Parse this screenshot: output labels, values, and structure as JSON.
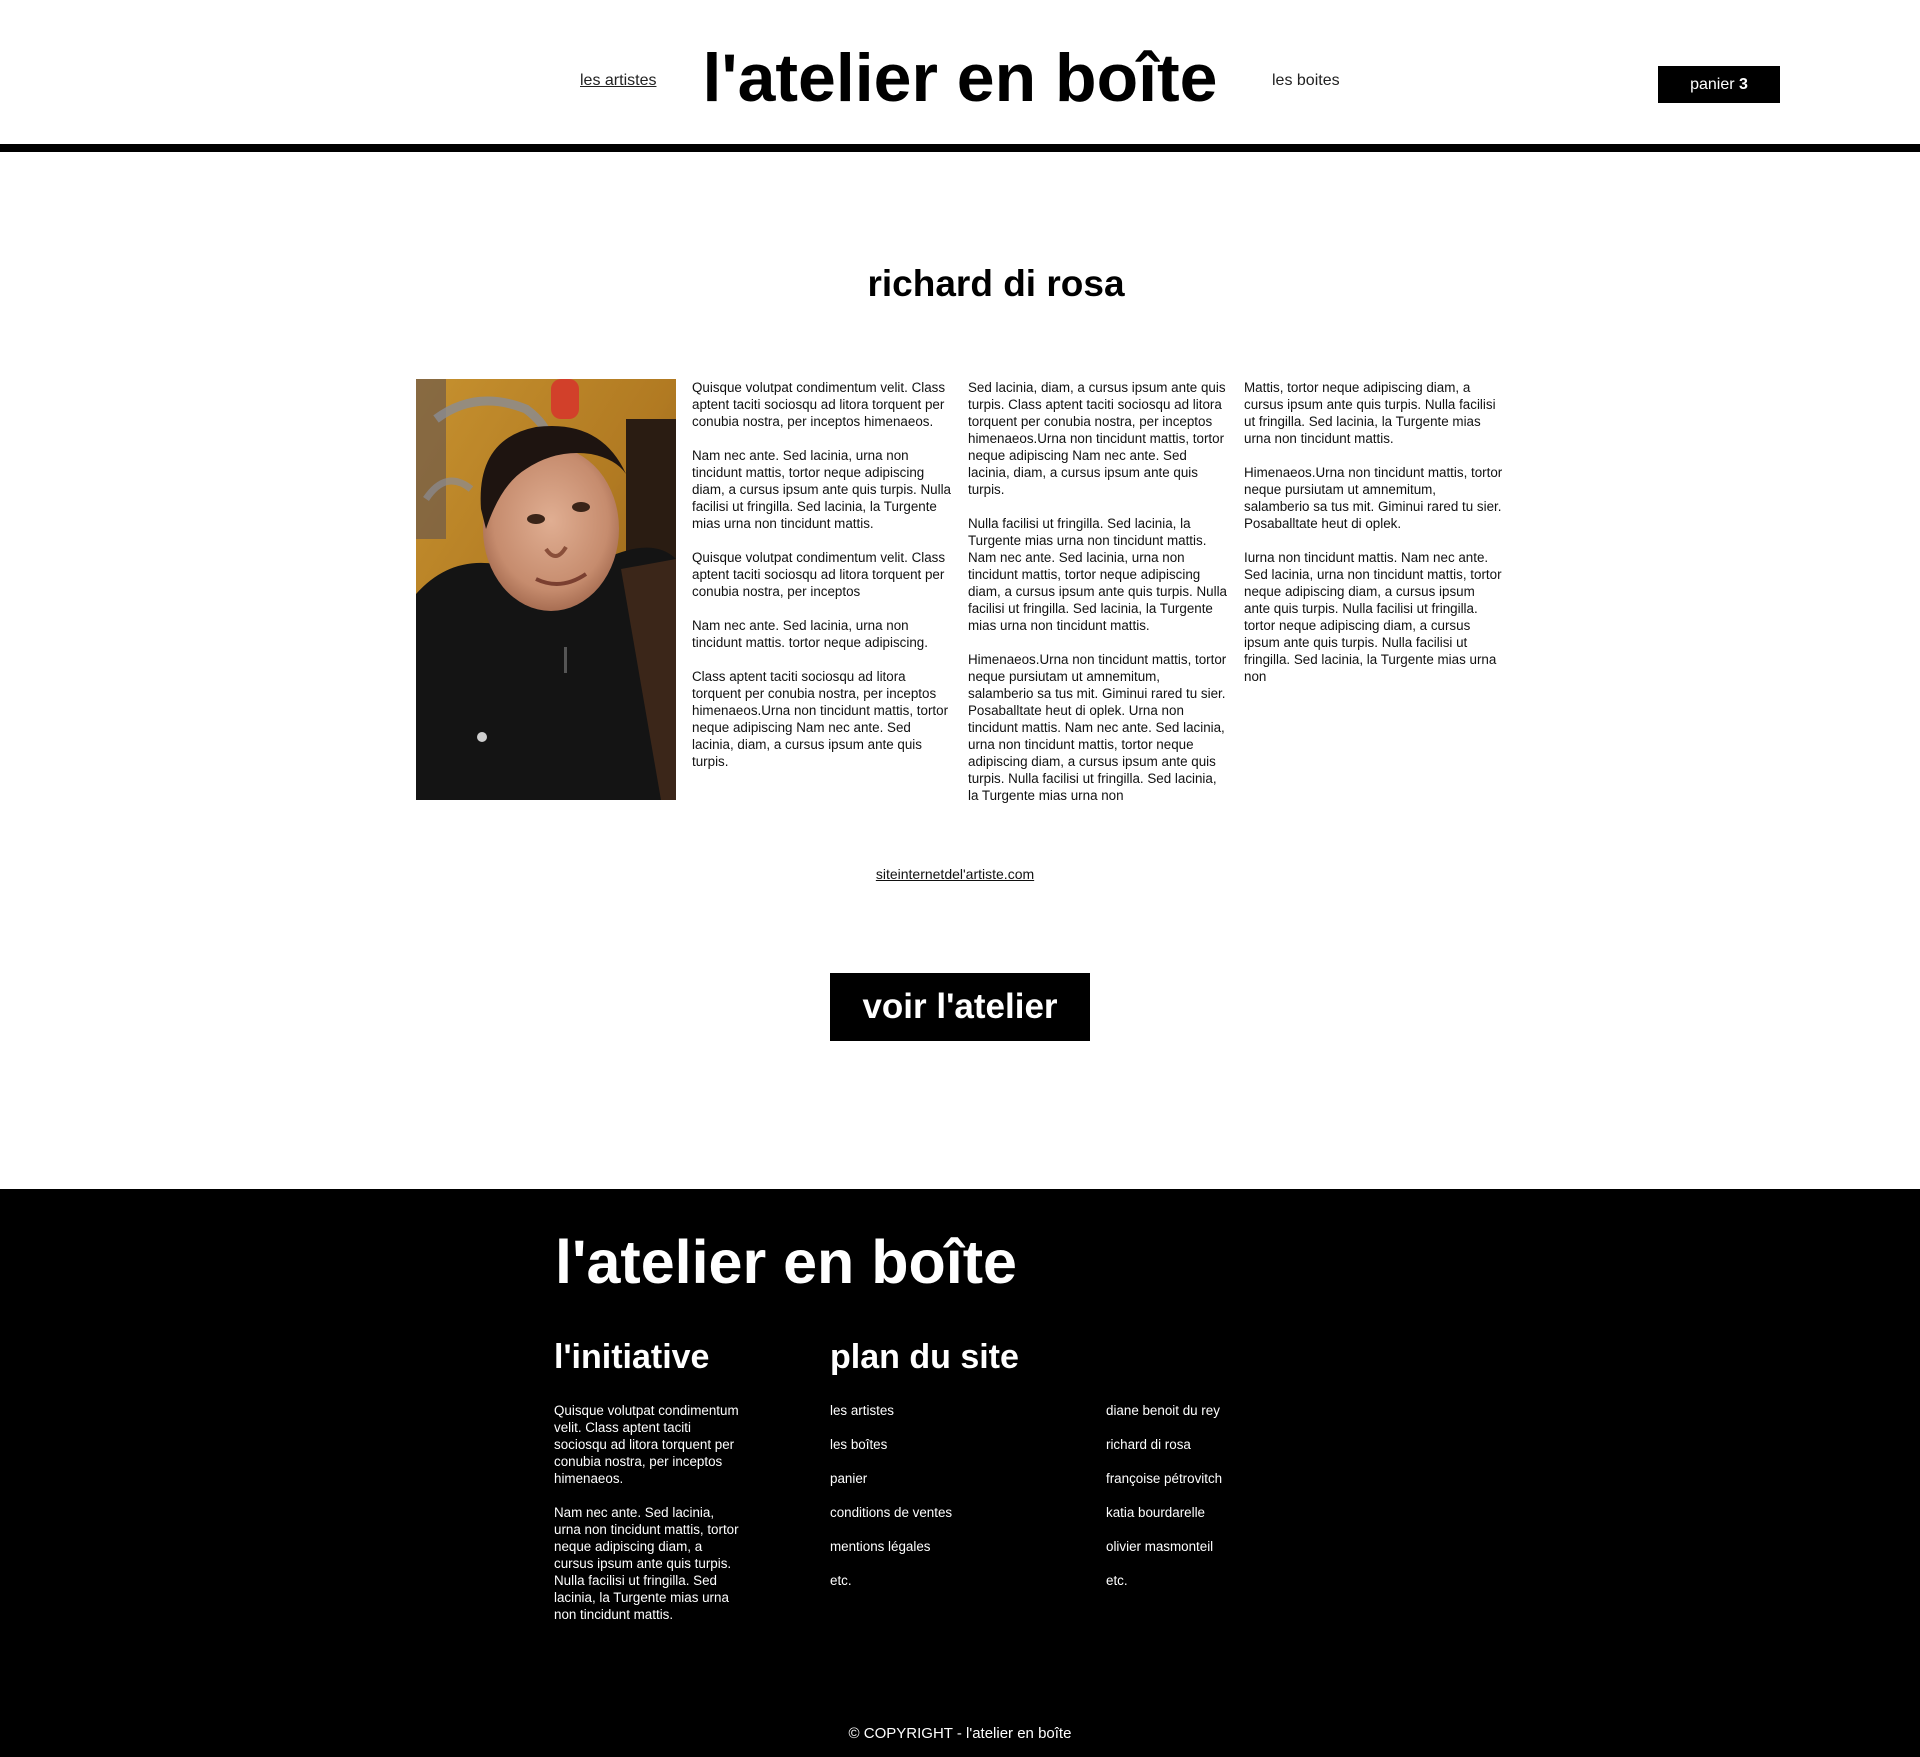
{
  "header": {
    "logo": "l'atelier en boîte",
    "nav_left": "les artistes",
    "nav_right": "les boites",
    "cart_label": "panier",
    "cart_count": "3"
  },
  "artist": {
    "name": "richard di rosa",
    "photo_alt": "portrait",
    "columns": [
      [
        "Quisque volutpat condimentum velit. Class aptent taciti sociosqu ad litora torquent per conubia nostra, per inceptos himenaeos.",
        "Nam nec ante. Sed lacinia, urna non tincidunt mattis, tortor neque adipiscing diam, a cursus ipsum ante quis turpis. Nulla facilisi ut fringilla. Sed lacinia, la Turgente mias urna non tincidunt mattis.",
        "Quisque volutpat condimentum velit. Class aptent taciti sociosqu ad litora torquent per conubia nostra, per inceptos",
        "Nam nec ante. Sed lacinia, urna non tincidunt mattis. tortor neque adipiscing.",
        "Class aptent taciti sociosqu ad litora torquent per conubia nostra, per inceptos himenaeos.Urna non tincidunt mattis, tortor neque adipiscing Nam nec ante. Sed lacinia, diam, a cursus ipsum ante quis turpis."
      ],
      [
        "Sed lacinia, diam, a cursus ipsum ante quis turpis. Class aptent taciti sociosqu ad litora torquent per conubia nostra, per inceptos himenaeos.Urna non tincidunt mattis, tortor neque adipiscing Nam nec ante. Sed lacinia, diam, a cursus ipsum ante quis turpis.",
        "Nulla facilisi ut fringilla. Sed lacinia, la Turgente mias urna non tincidunt mattis. Nam nec ante. Sed lacinia, urna non tincidunt mattis, tortor neque adipiscing diam, a cursus ipsum ante quis turpis. Nulla facilisi ut fringilla. Sed lacinia, la Turgente mias urna non tincidunt mattis.",
        "Himenaeos.Urna non tincidunt mattis, tortor neque pursiutam ut amnemitum, salamberio sa tus mit. Giminui rared tu sier. Posaballtate heut di oplek. Urna non tincidunt mattis. Nam nec ante. Sed lacinia, urna non tincidunt mattis, tortor neque adipiscing diam, a cursus ipsum ante quis turpis. Nulla facilisi ut fringilla. Sed lacinia, la Turgente mias urna non"
      ],
      [
        "Mattis, tortor neque adipiscing diam, a cursus ipsum ante quis turpis. Nulla facilisi ut fringilla. Sed lacinia, la Turgente mias urna non tincidunt mattis.",
        "Himenaeos.Urna non tincidunt mattis, tortor neque pursiutam ut amnemitum, salamberio sa tus mit. Giminui rared tu sier. Posaballtate heut di oplek.",
        "Iurna non tincidunt mattis. Nam nec ante. Sed lacinia, urna non tincidunt mattis, tortor neque adipiscing diam, a cursus ipsum ante quis turpis. Nulla facilisi ut fringilla. tortor neque adipiscing diam, a cursus ipsum ante quis turpis. Nulla facilisi ut fringilla. Sed lacinia, la Turgente mias urna non"
      ]
    ],
    "website": "siteinternetdel'artiste.com",
    "cta": "voir l'atelier"
  },
  "footer": {
    "logo": "l'atelier en boîte",
    "initiative_title": "l'initiative",
    "initiative_paragraphs": [
      "Quisque volutpat condimentum velit. Class aptent taciti sociosqu ad litora torquent per conubia nostra, per inceptos himenaeos.",
      "Nam nec ante. Sed lacinia, urna non tincidunt mattis, tortor neque adipiscing diam, a cursus ipsum ante quis turpis. Nulla facilisi ut fringilla. Sed lacinia, la Turgente mias urna non tincidunt mattis."
    ],
    "sitemap_title": "plan du site",
    "sitemap_col1": [
      "les artistes",
      "les boîtes",
      "panier",
      "conditions de ventes",
      "mentions légales",
      "etc."
    ],
    "sitemap_col2": [
      "diane benoit du rey",
      "richard di rosa",
      "françoise pétrovitch",
      "katia bourdarelle",
      "olivier masmonteil",
      "etc."
    ],
    "copyright": "© COPYRIGHT - l'atelier en boîte"
  },
  "colors": {
    "background": "#ffffff",
    "primary": "#000000",
    "text_on_dark": "#ffffff"
  }
}
